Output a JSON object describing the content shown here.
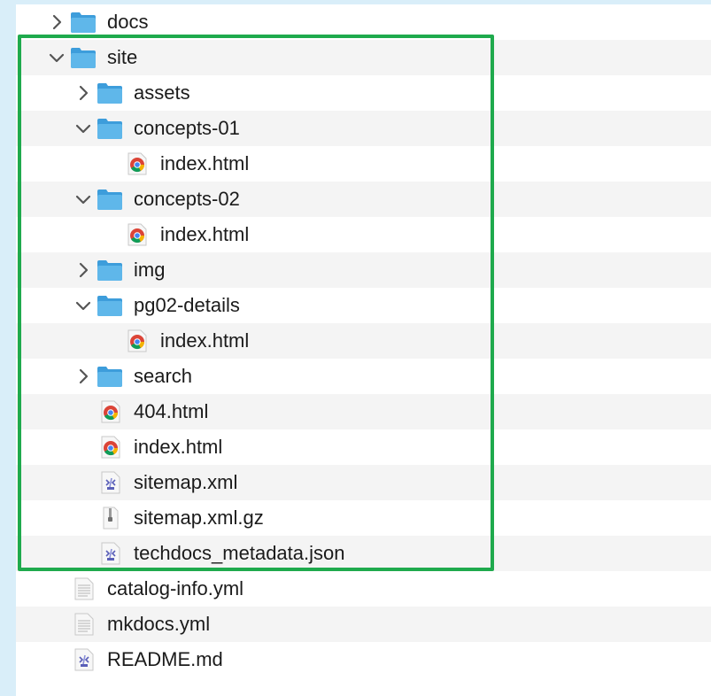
{
  "tree": {
    "rows": [
      {
        "label": "docs",
        "icon": "folder-icon",
        "chevron": "right",
        "depth": 0
      },
      {
        "label": "site",
        "icon": "folder-icon",
        "chevron": "down",
        "depth": 0
      },
      {
        "label": "assets",
        "icon": "folder-icon",
        "chevron": "right",
        "depth": 1
      },
      {
        "label": "concepts-01",
        "icon": "folder-icon",
        "chevron": "down",
        "depth": 1
      },
      {
        "label": "index.html",
        "icon": "chrome-html-icon",
        "chevron": "none",
        "depth": 2
      },
      {
        "label": "concepts-02",
        "icon": "folder-icon",
        "chevron": "down",
        "depth": 1
      },
      {
        "label": "index.html",
        "icon": "chrome-html-icon",
        "chevron": "none",
        "depth": 2
      },
      {
        "label": "img",
        "icon": "folder-icon",
        "chevron": "right",
        "depth": 1
      },
      {
        "label": "pg02-details",
        "icon": "folder-icon",
        "chevron": "down",
        "depth": 1
      },
      {
        "label": "index.html",
        "icon": "chrome-html-icon",
        "chevron": "none",
        "depth": 2
      },
      {
        "label": "search",
        "icon": "folder-icon",
        "chevron": "right",
        "depth": 1
      },
      {
        "label": "404.html",
        "icon": "chrome-html-icon",
        "chevron": "none",
        "depth": 1
      },
      {
        "label": "index.html",
        "icon": "chrome-html-icon",
        "chevron": "none",
        "depth": 1
      },
      {
        "label": "sitemap.xml",
        "icon": "xml-file-icon",
        "chevron": "none",
        "depth": 1
      },
      {
        "label": "sitemap.xml.gz",
        "icon": "archive-file-icon",
        "chevron": "none",
        "depth": 1
      },
      {
        "label": "techdocs_metadata.json",
        "icon": "xml-file-icon",
        "chevron": "none",
        "depth": 1
      },
      {
        "label": "catalog-info.yml",
        "icon": "text-file-icon",
        "chevron": "none",
        "depth": 0
      },
      {
        "label": "mkdocs.yml",
        "icon": "text-file-icon",
        "chevron": "none",
        "depth": 0
      },
      {
        "label": "README.md",
        "icon": "xml-file-icon",
        "chevron": "none",
        "depth": 0
      }
    ]
  },
  "colors": {
    "folder": "#5fb7ea",
    "highlight_border": "#1faa4d",
    "stripe": "#f4f4f4"
  }
}
